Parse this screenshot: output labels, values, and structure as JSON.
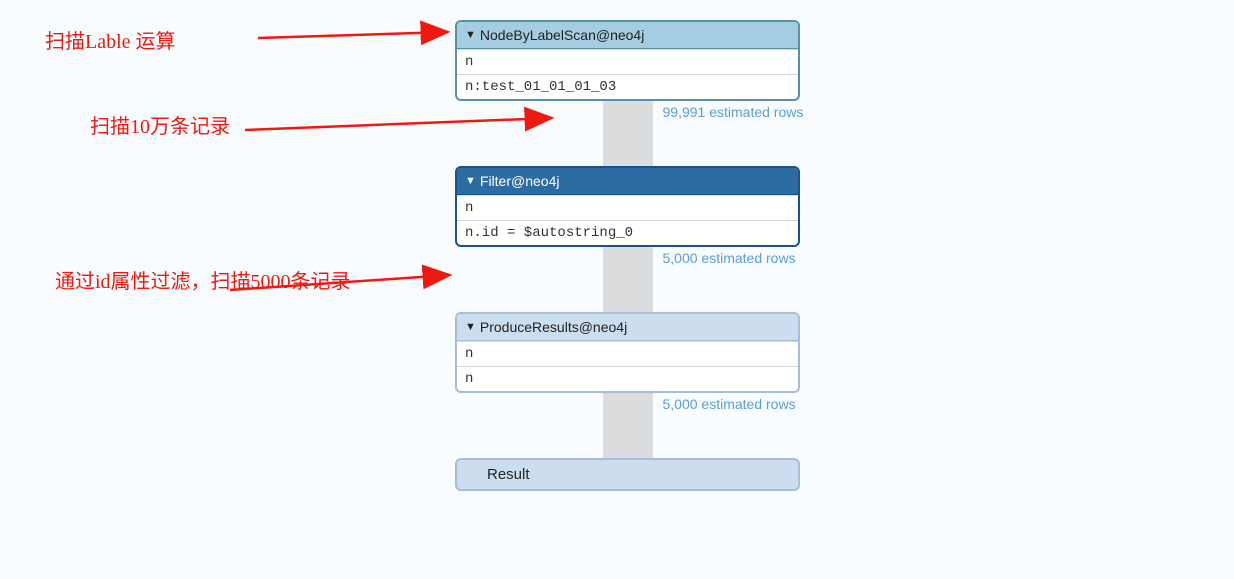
{
  "annotations": {
    "a1": "扫描Lable 运算",
    "a2": "扫描10万条记录",
    "a3": "通过id属性过滤，扫描5000条记录"
  },
  "plan": {
    "nodes": [
      {
        "title": "NodeByLabelScan@neo4j",
        "rows": [
          "n",
          "n:test_01_01_01_03"
        ],
        "estimated": "99,991 estimated rows"
      },
      {
        "title": "Filter@neo4j",
        "rows": [
          "n",
          "n.id = $autostring_0"
        ],
        "estimated": "5,000 estimated rows"
      },
      {
        "title": "ProduceResults@neo4j",
        "rows": [
          "n",
          "n"
        ],
        "estimated": "5,000 estimated rows"
      }
    ],
    "result_label": "Result"
  }
}
